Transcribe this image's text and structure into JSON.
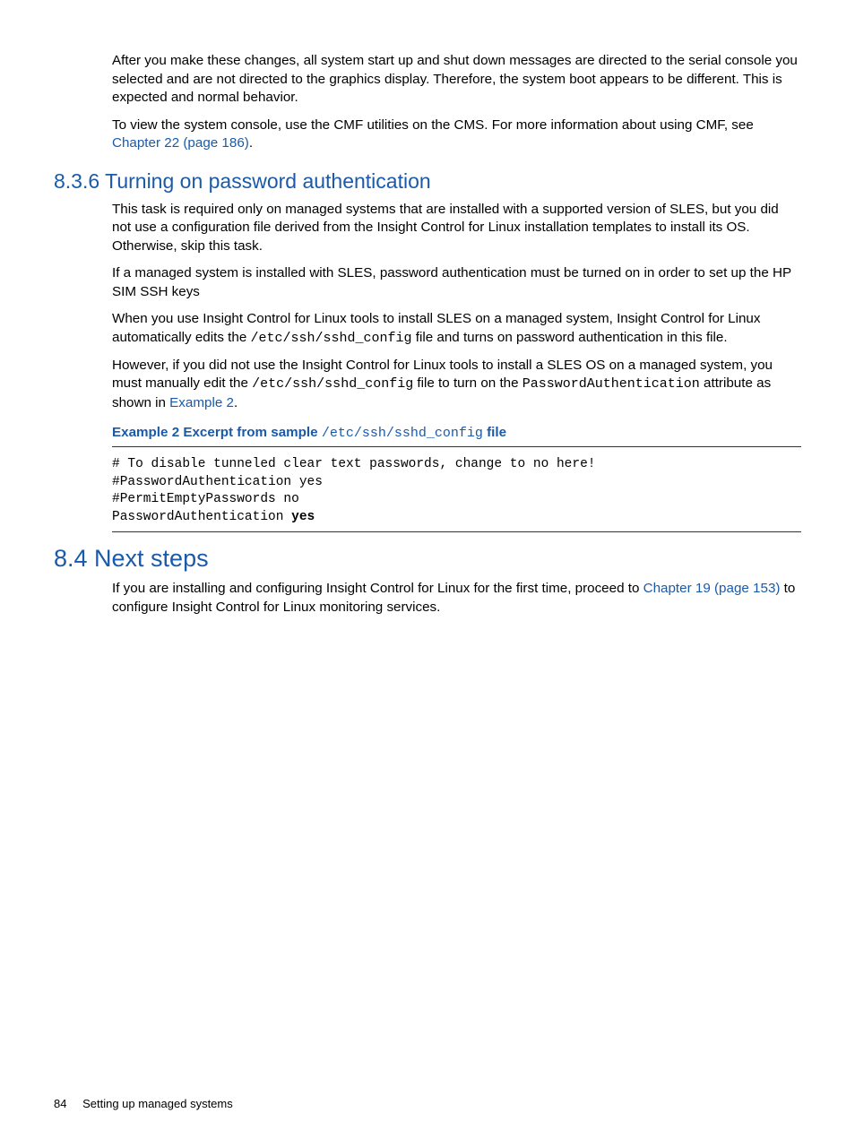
{
  "para1": "After you make these changes, all system start up and shut down messages are directed to the serial console you selected and are not directed to the graphics display. Therefore, the system boot appears to be different. This is expected and normal behavior.",
  "para2_a": "To view the system console, use the CMF utilities on the CMS. For more information about using CMF, see ",
  "para2_link": "Chapter 22 (page 186)",
  "para2_b": ".",
  "h836": "8.3.6 Turning on password authentication",
  "p836_1": "This task is required only on managed systems that are installed with a supported version of SLES, but you did not use a configuration file derived from the Insight Control for Linux installation templates to install its OS. Otherwise, skip this task.",
  "p836_2": "If a managed system is installed with SLES, password authentication must be turned on in order to set up the HP SIM SSH keys",
  "p836_3a": "When you use Insight Control for Linux tools to install SLES on a managed system, Insight Control for Linux automatically edits the ",
  "p836_3code": "/etc/ssh/sshd_config",
  "p836_3b": " file and turns on password authentication in this file.",
  "p836_4a": "However, if you did not use the Insight Control for Linux tools to install a SLES OS on a managed system, you must manually edit the ",
  "p836_4code1": "/etc/ssh/sshd_config",
  "p836_4b": " file to turn on the ",
  "p836_4code2": "PasswordAuthentication",
  "p836_4c": " attribute as shown in ",
  "p836_4link": "Example 2",
  "p836_4d": ".",
  "example_title_a": "Example 2 Excerpt from sample ",
  "example_title_code": "/etc/ssh/sshd_config",
  "example_title_b": " file",
  "code_line1": "# To disable tunneled clear text passwords, change to no here!",
  "code_line2": "#PasswordAuthentication yes",
  "code_line3": "#PermitEmptyPasswords no",
  "code_line4": "PasswordAuthentication ",
  "code_line4_bold": "yes",
  "h84": "8.4 Next steps",
  "p84_a": "If you are installing and configuring Insight Control for Linux for the first time, proceed to ",
  "p84_link": "Chapter 19 (page 153)",
  "p84_b": " to configure Insight Control for Linux monitoring services.",
  "footer_page": "84",
  "footer_title": "Setting up managed systems"
}
